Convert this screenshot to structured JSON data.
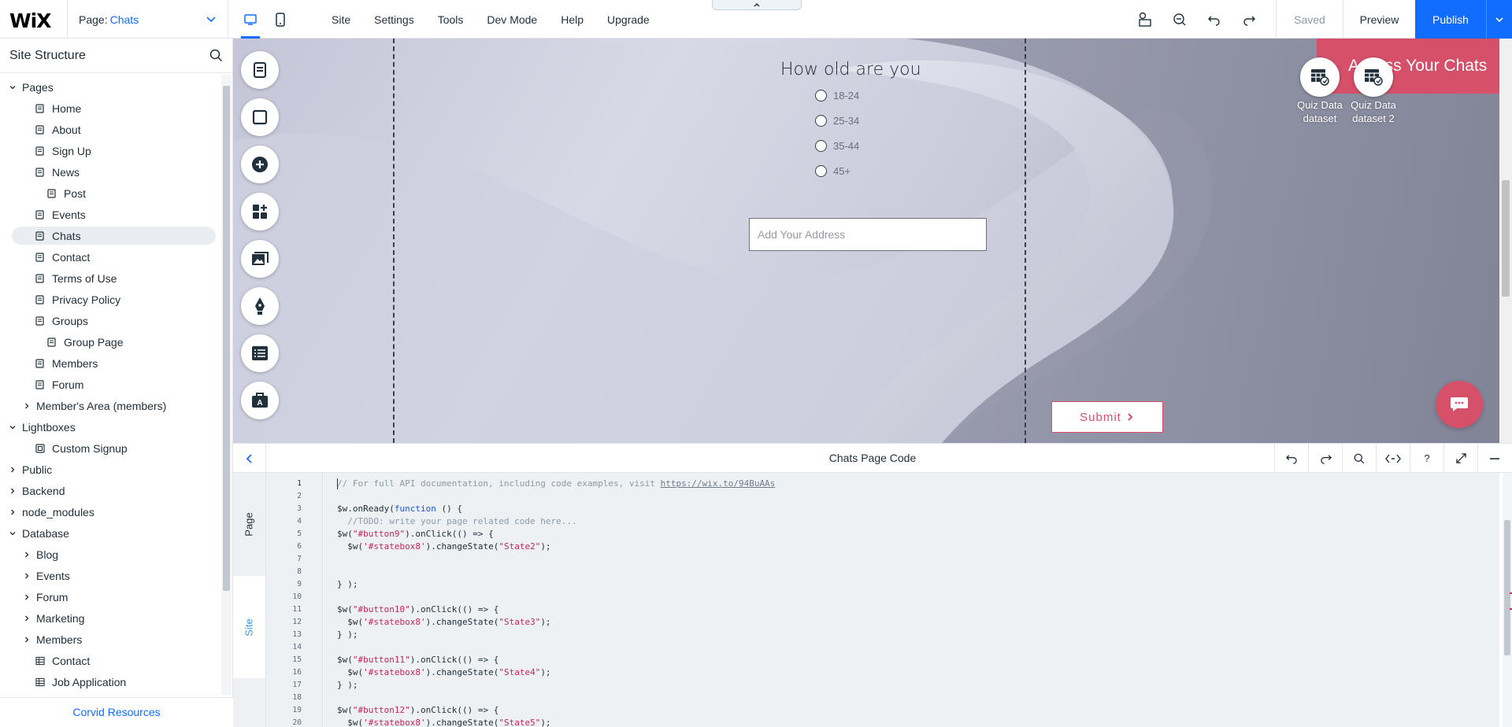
{
  "topbar": {
    "logo": "WiX",
    "page_label": "Page:",
    "page_value": "Chats",
    "menu": [
      "Site",
      "Settings",
      "Tools",
      "Dev Mode",
      "Help",
      "Upgrade"
    ],
    "saved": "Saved",
    "preview": "Preview",
    "publish": "Publish"
  },
  "sidebar": {
    "title": "Site Structure",
    "footer": "Corvid Resources",
    "tree": [
      {
        "label": "Pages",
        "level": 0,
        "caret": "down"
      },
      {
        "label": "Home",
        "level": 1,
        "icon": "page"
      },
      {
        "label": "About",
        "level": 1,
        "icon": "page"
      },
      {
        "label": "Sign Up",
        "level": 1,
        "icon": "page"
      },
      {
        "label": "News",
        "level": 1,
        "icon": "page"
      },
      {
        "label": "Post",
        "level": 2,
        "icon": "page"
      },
      {
        "label": "Events",
        "level": 1,
        "icon": "page"
      },
      {
        "label": "Chats",
        "level": 1,
        "icon": "page",
        "selected": true
      },
      {
        "label": "Contact",
        "level": 1,
        "icon": "page"
      },
      {
        "label": "Terms of Use",
        "level": 1,
        "icon": "page"
      },
      {
        "label": "Privacy Policy",
        "level": 1,
        "icon": "page"
      },
      {
        "label": "Groups",
        "level": 1,
        "icon": "page"
      },
      {
        "label": "Group Page",
        "level": 2,
        "icon": "page"
      },
      {
        "label": "Members",
        "level": 1,
        "icon": "page"
      },
      {
        "label": "Forum",
        "level": 1,
        "icon": "page"
      },
      {
        "label": "Member's Area (members)",
        "level": 1,
        "caret": "right"
      },
      {
        "label": "Lightboxes",
        "level": 0,
        "caret": "down"
      },
      {
        "label": "Custom Signup",
        "level": 1,
        "icon": "lightbox"
      },
      {
        "label": "Public",
        "level": 0,
        "caret": "right"
      },
      {
        "label": "Backend",
        "level": 0,
        "caret": "right"
      },
      {
        "label": "node_modules",
        "level": 0,
        "caret": "right"
      },
      {
        "label": "Database",
        "level": 0,
        "caret": "down"
      },
      {
        "label": "Blog",
        "level": 1,
        "caret": "right"
      },
      {
        "label": "Events",
        "level": 1,
        "caret": "right"
      },
      {
        "label": "Forum",
        "level": 1,
        "caret": "right"
      },
      {
        "label": "Marketing",
        "level": 1,
        "caret": "right"
      },
      {
        "label": "Members",
        "level": 1,
        "caret": "right"
      },
      {
        "label": "Contact",
        "level": 1,
        "icon": "table"
      },
      {
        "label": "Job Application",
        "level": 1,
        "icon": "table"
      }
    ]
  },
  "canvas": {
    "question": "How old are you",
    "options": [
      "18-24",
      "25-34",
      "35-44",
      "45+"
    ],
    "address_placeholder": "Add Your Address",
    "banner_text": "Access Your Chats",
    "dataset1": [
      "Quiz Data",
      "dataset"
    ],
    "dataset2": [
      "Quiz Data",
      "dataset 2"
    ],
    "submit": "Submit"
  },
  "code_panel": {
    "title": "Chats Page Code",
    "tab_page": "Page",
    "tab_site": "Site",
    "line_numbers": [
      "1",
      "2",
      "3",
      "4",
      "5",
      "6",
      "7",
      "8",
      "9",
      "10",
      "11",
      "12",
      "13",
      "14",
      "15",
      "16",
      "17",
      "18",
      "19",
      "20"
    ]
  },
  "colors": {
    "accent": "#116dff",
    "brand_pink": "#d6506a",
    "code_bg": "#eef1f4"
  }
}
